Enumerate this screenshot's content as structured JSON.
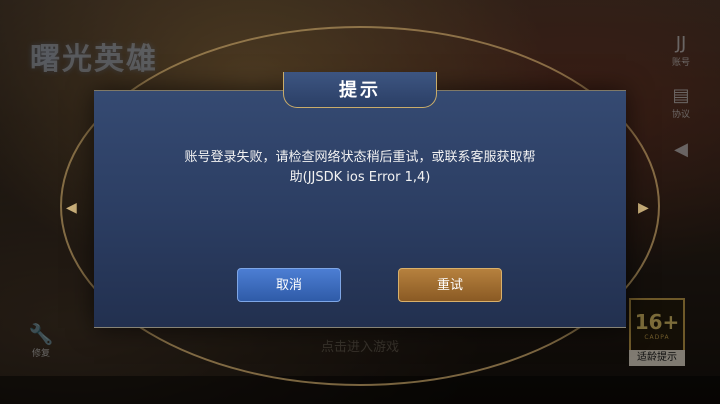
{
  "game": {
    "logo_text": "曙光英雄"
  },
  "side_buttons": [
    {
      "icon": "jj-icon",
      "glyph": "JJ",
      "label": "账号"
    },
    {
      "icon": "document-icon",
      "glyph": "▤",
      "label": "协议"
    },
    {
      "icon": "megaphone-icon",
      "glyph": "◀",
      "label": ""
    }
  ],
  "bottom_left": {
    "icon": "wrench-icon",
    "glyph": "🔧",
    "label": "修复"
  },
  "age_rating": {
    "number": "16+",
    "sub": "CADPA",
    "tip": "适龄提示"
  },
  "bottom_hint": "点击进入游戏",
  "dialog": {
    "title": "提示",
    "message": "账号登录失败，请检查网络状态稍后重试，或联系客服获取帮助(JJSDK ios Error 1,4)",
    "cancel_label": "取消",
    "retry_label": "重试"
  },
  "colors": {
    "dialog_bg": "#2c3e63",
    "cancel_button": "#3a68b8",
    "retry_button": "#a06e30",
    "gold_accent": "#c9ac6a"
  }
}
